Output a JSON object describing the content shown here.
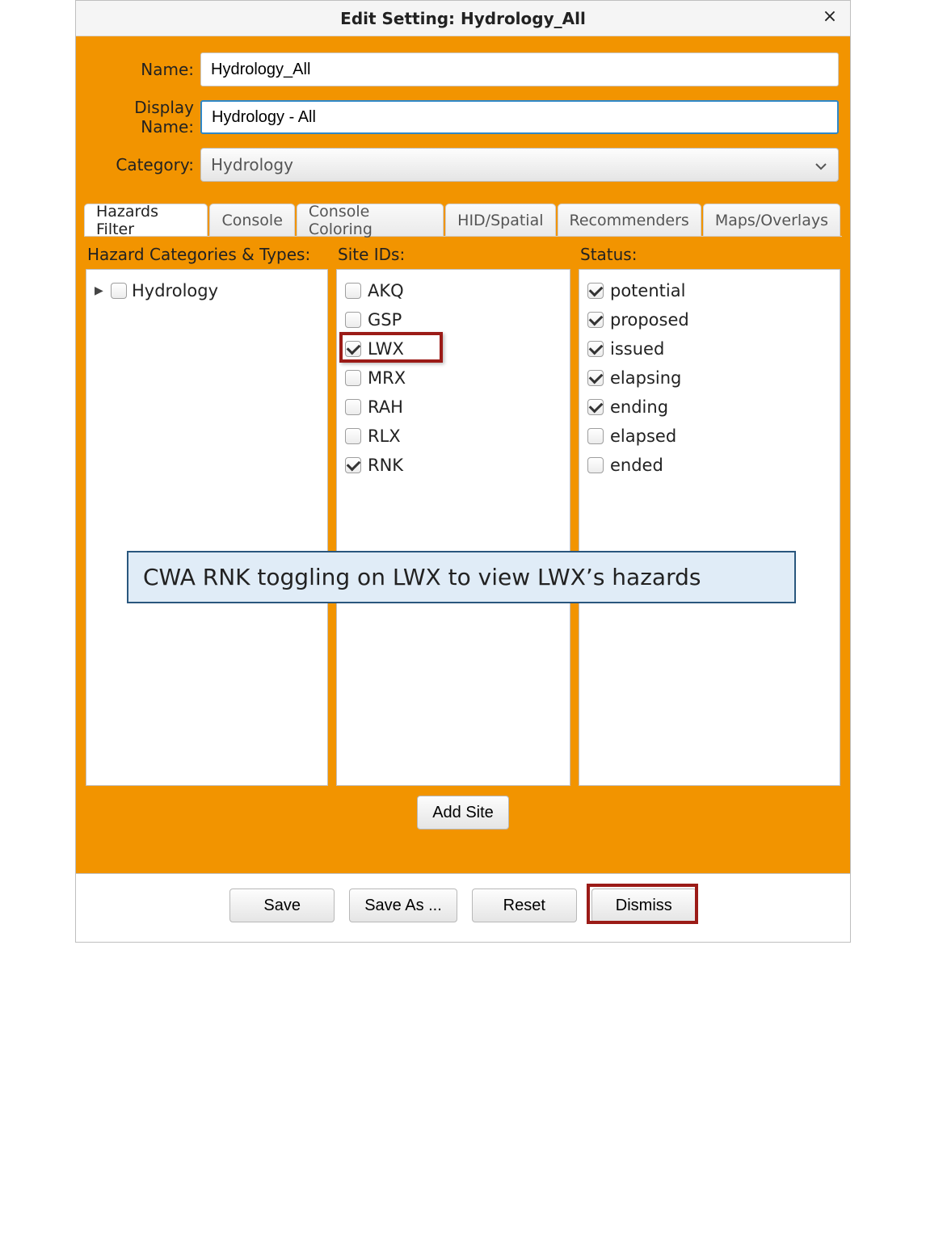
{
  "window": {
    "title": "Edit Setting: Hydrology_All"
  },
  "form": {
    "name_label": "Name:",
    "name_value": "Hydrology_All",
    "display_label": "Display Name:",
    "display_value": "Hydrology - All",
    "category_label": "Category:",
    "category_value": "Hydrology"
  },
  "tabs": [
    "Hazards Filter",
    "Console",
    "Console Coloring",
    "HID/Spatial",
    "Recommenders",
    "Maps/Overlays"
  ],
  "headers": {
    "hazard_types": "Hazard Categories & Types:",
    "site_ids": "Site IDs:",
    "status": "Status:"
  },
  "hazard_tree": [
    {
      "label": "Hydrology",
      "checked": false,
      "expandable": true
    }
  ],
  "site_ids": [
    {
      "label": "AKQ",
      "checked": false
    },
    {
      "label": "GSP",
      "checked": false
    },
    {
      "label": "LWX",
      "checked": true,
      "highlighted": true
    },
    {
      "label": "MRX",
      "checked": false
    },
    {
      "label": "RAH",
      "checked": false
    },
    {
      "label": "RLX",
      "checked": false
    },
    {
      "label": "RNK",
      "checked": true
    }
  ],
  "status": [
    {
      "label": "potential",
      "checked": true
    },
    {
      "label": "proposed",
      "checked": true
    },
    {
      "label": "issued",
      "checked": true
    },
    {
      "label": "elapsing",
      "checked": true
    },
    {
      "label": "ending",
      "checked": true
    },
    {
      "label": "elapsed",
      "checked": false
    },
    {
      "label": "ended",
      "checked": false
    }
  ],
  "annotation": "CWA RNK toggling on LWX to view LWX’s hazards",
  "buttons": {
    "add_site": "Add Site",
    "save": "Save",
    "save_as": "Save As ...",
    "reset": "Reset",
    "dismiss": "Dismiss"
  }
}
